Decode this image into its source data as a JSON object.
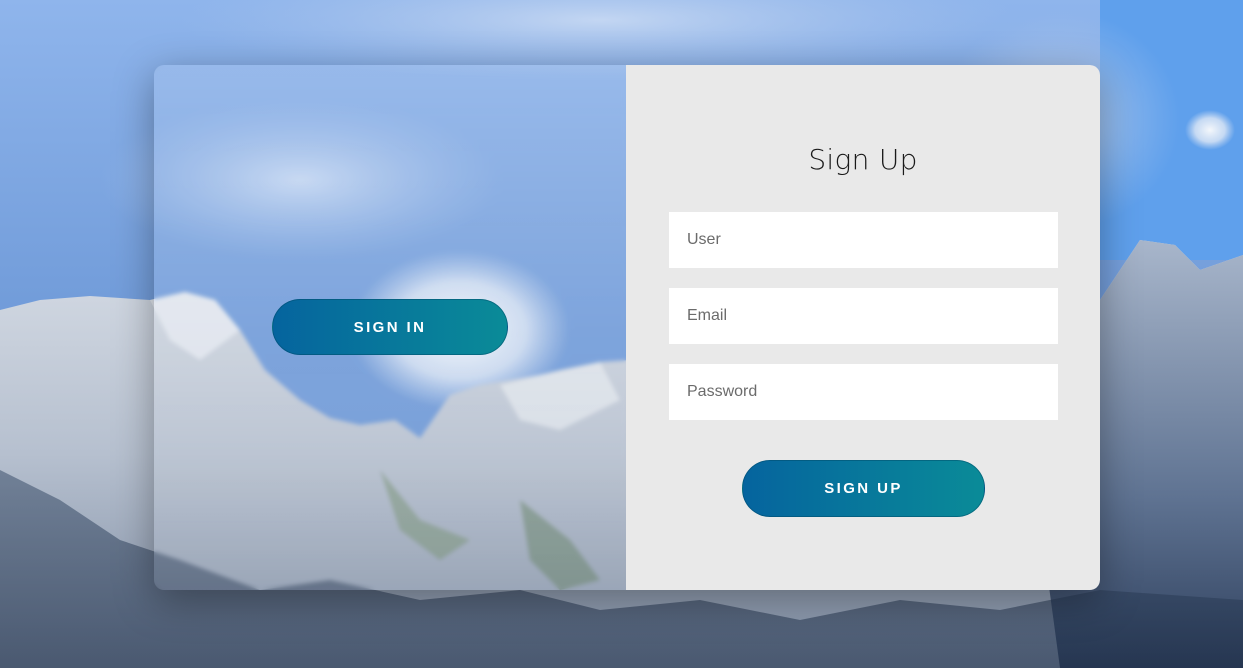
{
  "left_panel": {
    "signin_label": "SIGN IN"
  },
  "signup_form": {
    "title": "Sign Up",
    "user_placeholder": "User",
    "email_placeholder": "Email",
    "password_placeholder": "Password",
    "submit_label": "SIGN UP"
  },
  "colors": {
    "button_gradient_start": "#05649e",
    "button_gradient_end": "#0a8b98",
    "form_background": "#e9e9e9",
    "sky": "#7fa8e6"
  }
}
